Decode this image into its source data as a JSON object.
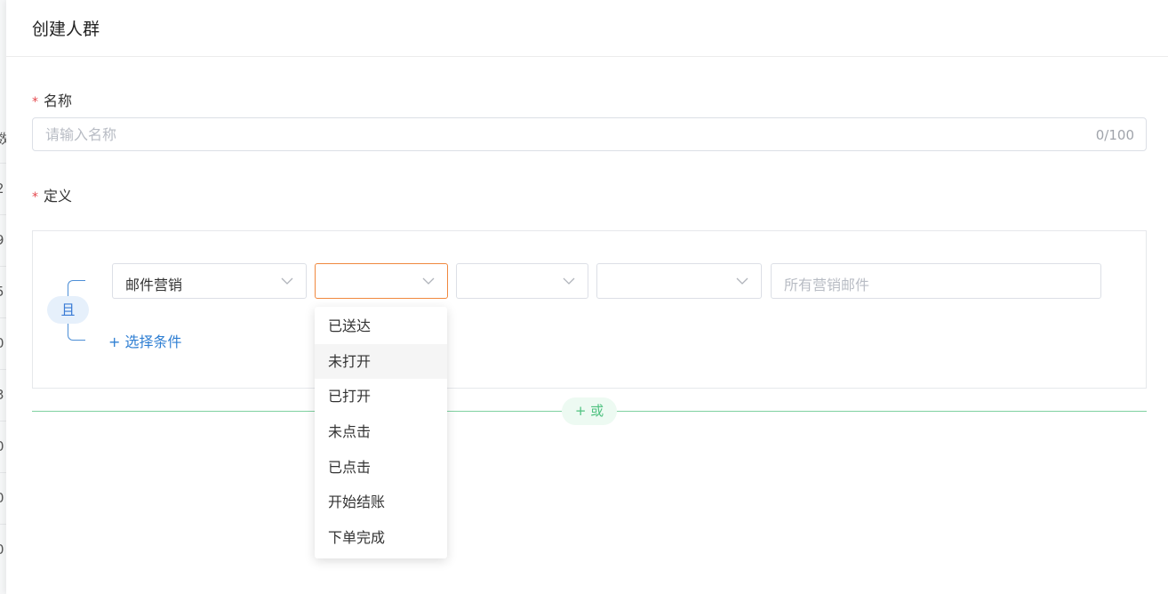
{
  "background_rows": [
    "数",
    "2",
    "9",
    "5",
    "0",
    "3",
    "0",
    "0",
    "0"
  ],
  "header": {
    "title": "创建人群"
  },
  "name_field": {
    "label": "名称",
    "placeholder": "请输入名称",
    "counter": "0/100"
  },
  "definition": {
    "label": "定义",
    "logic_badge": "且",
    "selects": [
      {
        "value": "邮件营销"
      },
      {
        "value": ""
      },
      {
        "value": ""
      },
      {
        "value": ""
      }
    ],
    "email_filter_placeholder": "所有营销邮件",
    "add_condition_label": "+ 选择条件"
  },
  "or_button_label": "+ 或",
  "dropdown": {
    "options": [
      "已送达",
      "未打开",
      "已打开",
      "未点击",
      "已点击",
      "开始结账",
      "下单完成"
    ],
    "hovered_index": 1
  },
  "colors": {
    "accent_blue": "#2f7fd3",
    "active_orange": "#f0883e",
    "green": "#4fc280",
    "required_red": "#e5484d"
  },
  "icons": {
    "chevron": "chevron-down-icon"
  }
}
